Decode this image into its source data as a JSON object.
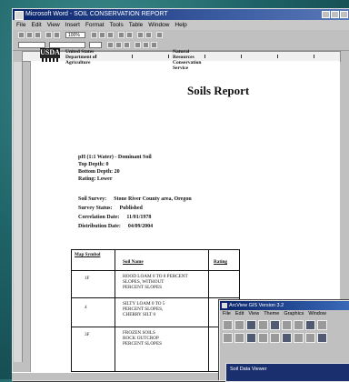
{
  "word_window": {
    "title": "Microsoft Word - SOIL CONSERVATION REPORT",
    "menu": [
      "File",
      "Edit",
      "View",
      "Insert",
      "Format",
      "Tools",
      "Table",
      "Window",
      "Help"
    ],
    "zoom": "100%"
  },
  "document": {
    "logo_text": "USDA",
    "agency_left": [
      "United States",
      "Department of",
      "Agriculture"
    ],
    "agency_right": [
      "Natural",
      "Resources",
      "Conservation",
      "Service"
    ],
    "title": "Soils Report",
    "fields": [
      {
        "label": "pH (1:1 Water) - Dominant Soil",
        "value": ""
      },
      {
        "label": "Top Depth: 0",
        "value": ""
      },
      {
        "label": "Bottom Depth: 20",
        "value": ""
      },
      {
        "label": "Rating: Lower",
        "value": ""
      },
      {
        "label": "Soil Survey:",
        "value": "Stone River County area, Oregon"
      },
      {
        "label": "Survey Status:",
        "value": "Published"
      },
      {
        "label": "Correlation Date:",
        "value": "11/01/1978"
      },
      {
        "label": "Distribution Date:",
        "value": "04/09/2004"
      }
    ],
    "table": {
      "headers": [
        "Map Symbol",
        "Soil Name",
        "Rating"
      ],
      "rows": [
        {
          "symbol": "1F",
          "name": [
            "HOOD LOAM 0 TO 8 PERCENT",
            "SLOPES, WITHOUT",
            "PERCENT SLOPES"
          ]
        },
        {
          "symbol": "4",
          "name": [
            "SILTY LOAM 0 TO 5",
            "PERCENT SLOPES,",
            "CHERRY SILT 0"
          ]
        },
        {
          "symbol": "3F",
          "name": [
            "FROZEN SOILS",
            "ROCK OUTCROP",
            "PERCENT SLOPES"
          ]
        }
      ]
    }
  },
  "gis_window": {
    "title": "ArcView GIS Version 3.2",
    "menu": [
      "File",
      "Edit",
      "View",
      "Theme",
      "Graphics",
      "Window"
    ],
    "panel_title": "Soil Data Viewer"
  }
}
